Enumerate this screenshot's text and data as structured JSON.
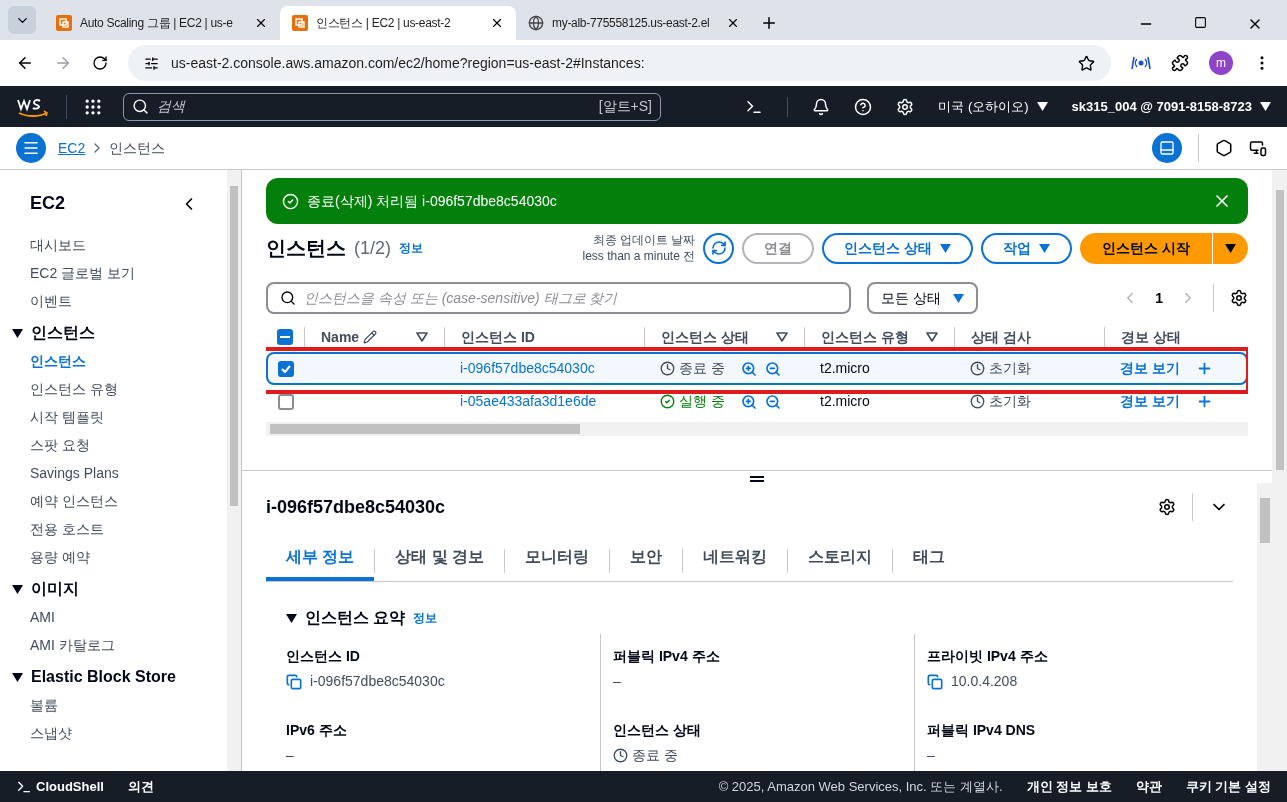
{
  "browser": {
    "tabs": [
      {
        "title": "Auto Scaling 그룹 | EC2 | us-e",
        "selected": false
      },
      {
        "title": "인스턴스 | EC2 | us-east-2",
        "selected": true
      },
      {
        "title": "my-alb-775558125.us-east-2.el",
        "selected": false
      }
    ],
    "url": "us-east-2.console.aws.amazon.com/ec2/home?region=us-east-2#Instances:",
    "profile": "m"
  },
  "aws_nav": {
    "search_placeholder": "검색",
    "shortcut": "[알트+S]",
    "region": "미국 (오하이오)",
    "account": "sk315_004 @ 7091-8158-8723"
  },
  "breadcrumb": [
    {
      "label": "EC2",
      "kind": "link"
    },
    {
      "label": "인스턴스",
      "kind": "current"
    }
  ],
  "sidebar": {
    "title": "EC2",
    "items": [
      {
        "kind": "link",
        "label": "대시보드",
        "selected": false
      },
      {
        "kind": "link",
        "label": "EC2 글로벌 보기",
        "selected": false
      },
      {
        "kind": "link",
        "label": "이벤트",
        "selected": false
      },
      {
        "kind": "section",
        "label": "인스턴스",
        "expanded": true,
        "children": [
          {
            "label": "인스턴스",
            "selected": true
          },
          {
            "label": "인스턴스 유형",
            "selected": false
          },
          {
            "label": "시작 템플릿",
            "selected": false
          },
          {
            "label": "스팟 요청",
            "selected": false
          },
          {
            "label": "Savings Plans",
            "selected": false
          },
          {
            "label": "예약 인스턴스",
            "selected": false
          },
          {
            "label": "전용 호스트",
            "selected": false
          },
          {
            "label": "용량 예약",
            "selected": false
          }
        ]
      },
      {
        "kind": "section",
        "label": "이미지",
        "expanded": true,
        "children": [
          {
            "label": "AMI",
            "selected": false
          },
          {
            "label": "AMI 카탈로그",
            "selected": false
          }
        ]
      },
      {
        "kind": "section",
        "label": "Elastic Block Store",
        "expanded": true,
        "children": [
          {
            "label": "볼륨",
            "selected": false
          },
          {
            "label": "스냅샷",
            "selected": false
          }
        ]
      }
    ]
  },
  "flash": {
    "message": "종료(삭제) 처리됨 i-096f57dbe8c54030c"
  },
  "instances": {
    "title": "인스턴스",
    "count": "(1/2)",
    "info": "정보",
    "last_updated": [
      "최종 업데이트 날짜",
      "less than a minute 전"
    ],
    "buttons": [
      {
        "kind": "outline",
        "label": "연결",
        "disabled": true
      },
      {
        "kind": "dropdown",
        "label": "인스턴스 상태",
        "disabled": false
      },
      {
        "kind": "dropdown",
        "label": "작업",
        "disabled": false
      },
      {
        "kind": "primary",
        "label": "인스턴스 시작",
        "disabled": false
      }
    ],
    "search_placeholder": "인스턴스을 속성 또는 (case-sensitive) 태그로 찾기",
    "filter": "모든 상태",
    "page": "1",
    "select_all": {
      "indeterminate": true
    },
    "columns": [
      {
        "label": "Name",
        "editable": true,
        "sortable": true
      },
      {
        "label": "인스턴스 ID",
        "editable": false,
        "sortable": false
      },
      {
        "label": "인스턴스 상태",
        "editable": false,
        "sortable": true
      },
      {
        "label": "인스턴스 유형",
        "editable": false,
        "sortable": true
      },
      {
        "label": "상태 검사",
        "editable": false,
        "sortable": false
      },
      {
        "label": "경보 상태",
        "editable": false,
        "sortable": false
      }
    ],
    "rows": [
      {
        "checked": true,
        "selected": true,
        "highlighted": true,
        "id": "i-096f57dbe8c54030c",
        "state": "종료 중",
        "running": false,
        "type": "t2.micro",
        "check": "초기화",
        "alarm": "경보 보기"
      },
      {
        "checked": false,
        "selected": false,
        "highlighted": false,
        "id": "i-05ae433afa3d1e6de",
        "state": "실행 중",
        "running": true,
        "type": "t2.micro",
        "check": "초기화",
        "alarm": "경보 보기"
      }
    ]
  },
  "details": {
    "title": "i-096f57dbe8c54030c",
    "tabs": [
      {
        "label": "세부 정보",
        "selected": true
      },
      {
        "label": "상태 및 경보",
        "selected": false
      },
      {
        "label": "모니터링",
        "selected": false
      },
      {
        "label": "보안",
        "selected": false
      },
      {
        "label": "네트워킹",
        "selected": false
      },
      {
        "label": "스토리지",
        "selected": false
      },
      {
        "label": "태그",
        "selected": false
      }
    ],
    "section": "인스턴스 요약",
    "info": "정보",
    "columns": [
      [
        {
          "label": "인스턴스 ID",
          "value": "i-096f57dbe8c54030c",
          "kind": "copy"
        },
        {
          "label": "IPv6 주소",
          "value": "–",
          "kind": "plain"
        }
      ],
      [
        {
          "label": "퍼블릭 IPv4 주소",
          "value": "–",
          "kind": "plain"
        },
        {
          "label": "인스턴스 상태",
          "value": "종료 중",
          "kind": "pending"
        }
      ],
      [
        {
          "label": "프라이빗 IPv4 주소",
          "value": "10.0.4.208",
          "kind": "copy"
        },
        {
          "label": "퍼블릭 IPv4 DNS",
          "value": "–",
          "kind": "plain"
        }
      ]
    ]
  },
  "footer": {
    "cloudshell": "CloudShell",
    "feedback": "의견",
    "copyright": "© 2025, Amazon Web Services, Inc. 또는 계열사.",
    "links": [
      "개인 정보 보호",
      "약관",
      "쿠키 기본 설정"
    ]
  }
}
